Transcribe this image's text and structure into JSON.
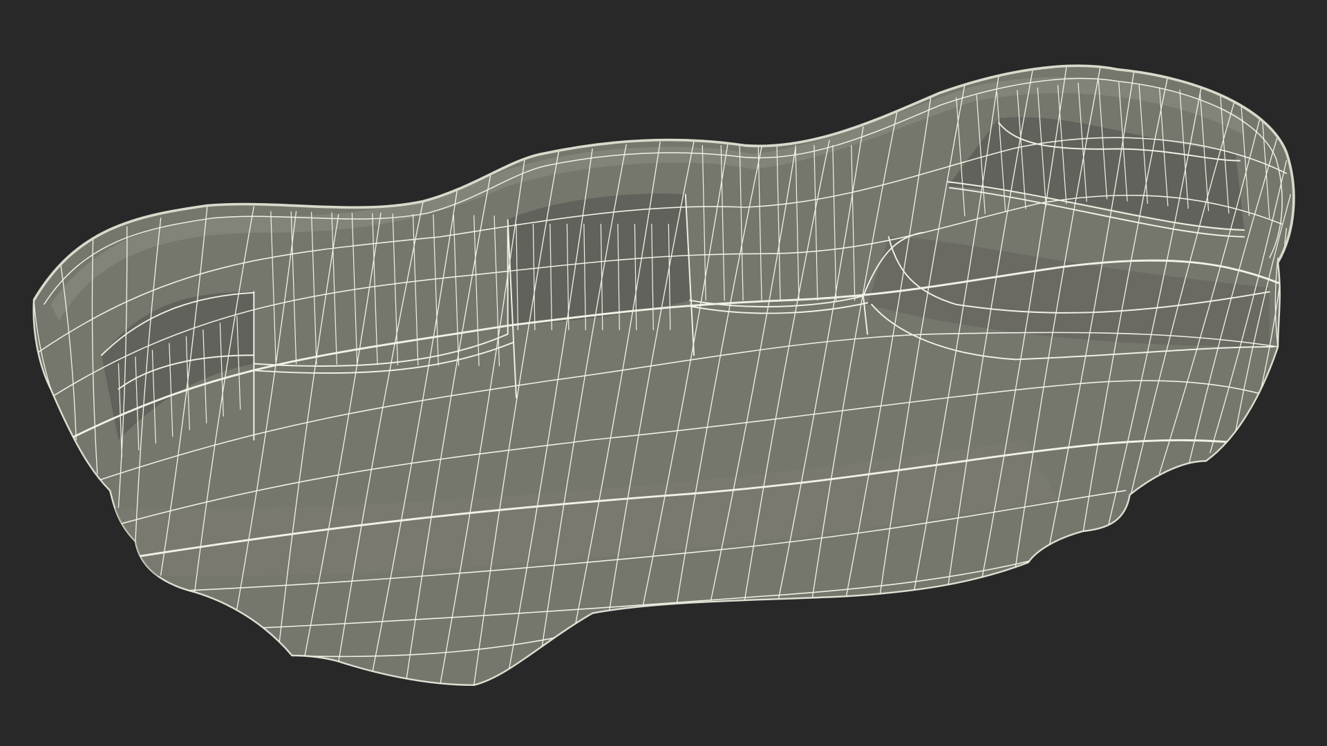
{
  "scene": {
    "subject": "pool-shell-wireframe",
    "colors": {
      "background": "#282828",
      "surface": "#75766c",
      "surface_dark": "#5f605a",
      "surface_light": "#85867b",
      "wire": "#f1f1e6",
      "rim": "#d9d9cc"
    }
  }
}
